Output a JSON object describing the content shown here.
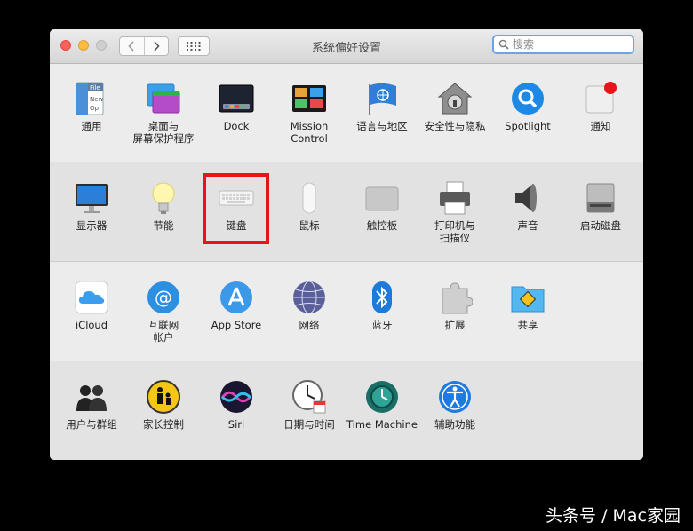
{
  "window": {
    "title": "系统偏好设置"
  },
  "search": {
    "placeholder": "搜索"
  },
  "rows": [
    [
      {
        "label": "通用",
        "icon": "general-icon"
      },
      {
        "label": "桌面与\n屏幕保护程序",
        "icon": "desktop-screensaver-icon"
      },
      {
        "label": "Dock",
        "icon": "dock-icon"
      },
      {
        "label": "Mission\nControl",
        "icon": "mission-control-icon"
      },
      {
        "label": "语言与地区",
        "icon": "language-region-icon"
      },
      {
        "label": "安全性与隐私",
        "icon": "security-privacy-icon"
      },
      {
        "label": "Spotlight",
        "icon": "spotlight-icon"
      },
      {
        "label": "通知",
        "icon": "notifications-icon"
      }
    ],
    [
      {
        "label": "显示器",
        "icon": "displays-icon"
      },
      {
        "label": "节能",
        "icon": "energy-saver-icon"
      },
      {
        "label": "键盘",
        "icon": "keyboard-icon"
      },
      {
        "label": "鼠标",
        "icon": "mouse-icon"
      },
      {
        "label": "触控板",
        "icon": "trackpad-icon"
      },
      {
        "label": "打印机与\n扫描仪",
        "icon": "printers-scanners-icon"
      },
      {
        "label": "声音",
        "icon": "sound-icon"
      },
      {
        "label": "启动磁盘",
        "icon": "startup-disk-icon"
      }
    ],
    [
      {
        "label": "iCloud",
        "icon": "icloud-icon"
      },
      {
        "label": "互联网\n帐户",
        "icon": "internet-accounts-icon"
      },
      {
        "label": "App Store",
        "icon": "app-store-icon"
      },
      {
        "label": "网络",
        "icon": "network-icon"
      },
      {
        "label": "蓝牙",
        "icon": "bluetooth-icon"
      },
      {
        "label": "扩展",
        "icon": "extensions-icon"
      },
      {
        "label": "共享",
        "icon": "sharing-icon"
      }
    ],
    [
      {
        "label": "用户与群组",
        "icon": "users-groups-icon"
      },
      {
        "label": "家长控制",
        "icon": "parental-controls-icon"
      },
      {
        "label": "Siri",
        "icon": "siri-icon"
      },
      {
        "label": "日期与时间",
        "icon": "date-time-icon"
      },
      {
        "label": "Time Machine",
        "icon": "time-machine-icon"
      },
      {
        "label": "辅助功能",
        "icon": "accessibility-icon"
      }
    ]
  ],
  "highlight": {
    "target": "键盘",
    "color": "#e8141b"
  },
  "watermark": "头条号 / Mac家园"
}
